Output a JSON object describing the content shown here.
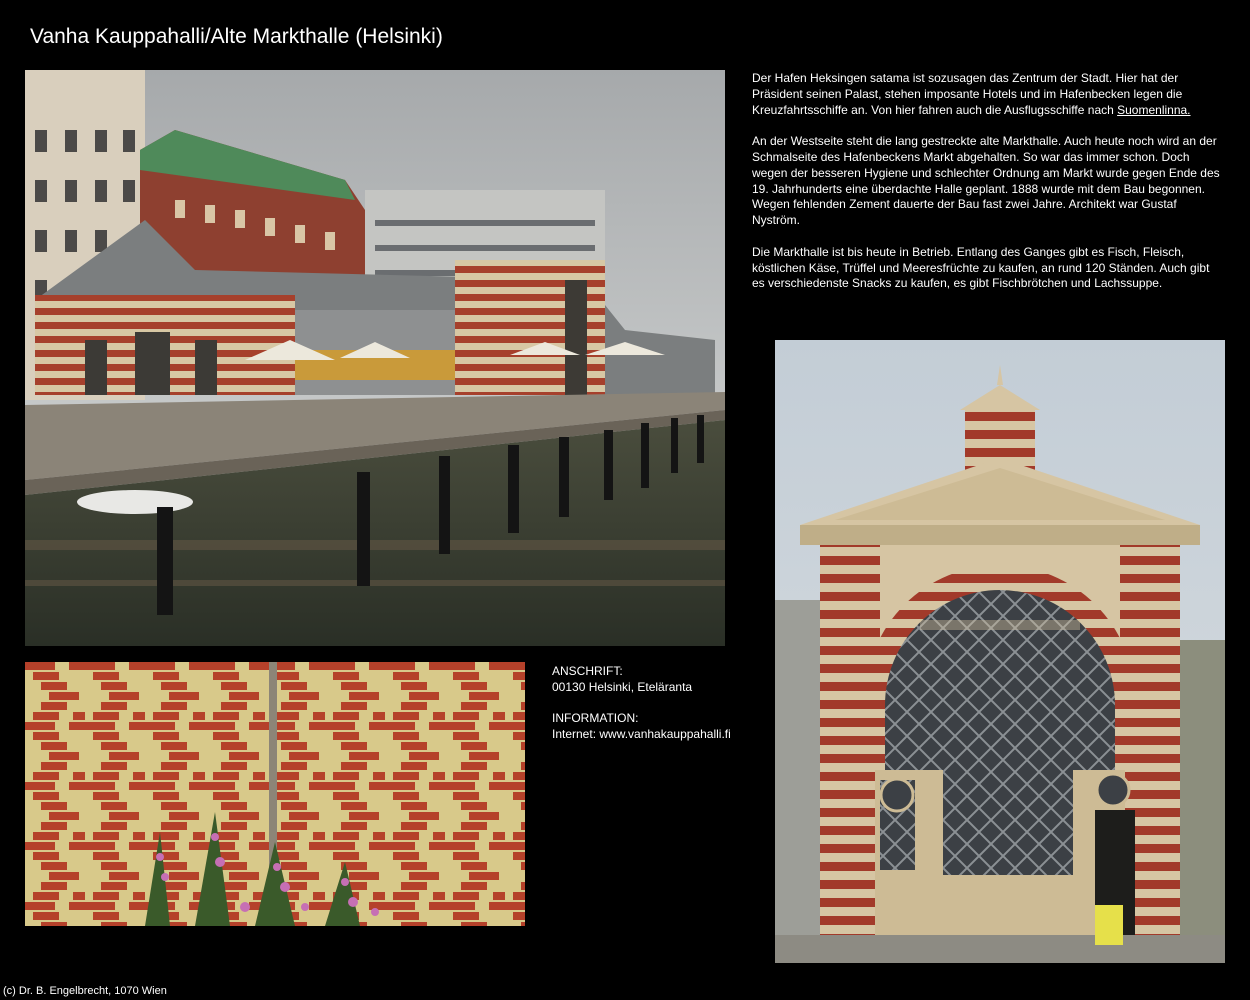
{
  "page": {
    "title": "Vanha Kauppahalli/Alte Markthalle (Helsinki)",
    "footer": "(c) Dr. B. Engelbrecht, 1070 Wien"
  },
  "description": {
    "p1_text": "Der Hafen Heksingen satama ist sozusagen das Zentrum der Stadt. Hier hat der Präsident seinen Palast, stehen imposante Hotels und im Hafenbecken legen die Kreuzfahrtsschiffe an. Von hier fahren auch die Ausflugsschiffe nach ",
    "p1_link": "Suomenlinna.",
    "p2": "An der Westseite steht die lang gestreckte alte Markthalle. Auch heute noch wird an der Schmalseite des Hafenbeckens Markt abgehalten. So war das immer schon. Doch wegen der besseren Hygiene und schlechter Ordnung am Markt wurde gegen Ende des 19. Jahrhunderts eine überdachte Halle geplant. 1888 wurde mit dem Bau begonnen. Wegen fehlenden Zement dauerte der Bau fast zwei Jahre. Architekt war Gustaf Nyström.",
    "p3": "Die Markthalle ist bis heute in Betrieb. Entlang des Ganges gibt es Fisch, Fleisch, köstlichen Käse, Trüffel und Meeresfrüchte zu kaufen, an rund 120 Ständen. Auch gibt es verschiedenste Snacks zu kaufen, es gibt Fischbrötchen und Lachssuppe."
  },
  "info": {
    "address_label": "ANSCHRIFT:",
    "address": "00130 Helsinki, Eteläranta",
    "info_label": "INFORMATION:",
    "internet": "Internet: www.vanhakauppahalli.fi"
  },
  "photos": {
    "harbor_photo": "harbor-market-hall-photo",
    "brick_photo": "brick-wall-pattern-photo",
    "facade_photo": "market-hall-facade-photo"
  },
  "colors": {
    "background": "#000000",
    "text": "#ffffff",
    "brick_red": "#b5412a",
    "brick_yellow": "#d8c98a"
  }
}
